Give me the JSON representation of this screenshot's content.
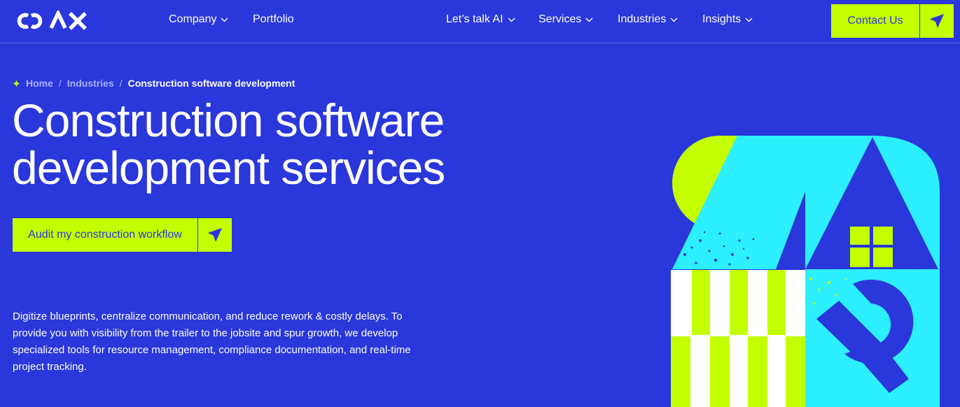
{
  "nav": {
    "logo_text": "COAX",
    "items": [
      {
        "label": "Company",
        "dropdown": true
      },
      {
        "label": "Portfolio",
        "dropdown": false
      },
      {
        "label": "Let’s talk AI",
        "dropdown": true
      },
      {
        "label": "Services",
        "dropdown": true
      },
      {
        "label": "Industries",
        "dropdown": true
      },
      {
        "label": "Insights",
        "dropdown": true
      }
    ],
    "contact_label": "Contact Us"
  },
  "breadcrumb": {
    "home": "Home",
    "separator": "/",
    "industries": "Industries",
    "current": "Construction software development"
  },
  "hero": {
    "title_line1": "Construction software",
    "title_line2": "development services",
    "cta_label": "Audit my construction workflow",
    "description": "Digitize blueprints, centralize communication, and reduce rework & costly delays. To provide you with visibility from the trailer to the jobsite and spur growth, we develop specialized tools for resource management, compliance documentation, and real-time project tracking."
  },
  "colors": {
    "background": "#2a37db",
    "accent_lime": "#c4ff00",
    "accent_cyan": "#2cf0ff",
    "text": "#ffffff"
  },
  "icons": [
    "coax-logo",
    "chevron-down-icon",
    "paper-plane-arrow-icon",
    "sparkle-icon",
    "construction-house-illustration"
  ]
}
